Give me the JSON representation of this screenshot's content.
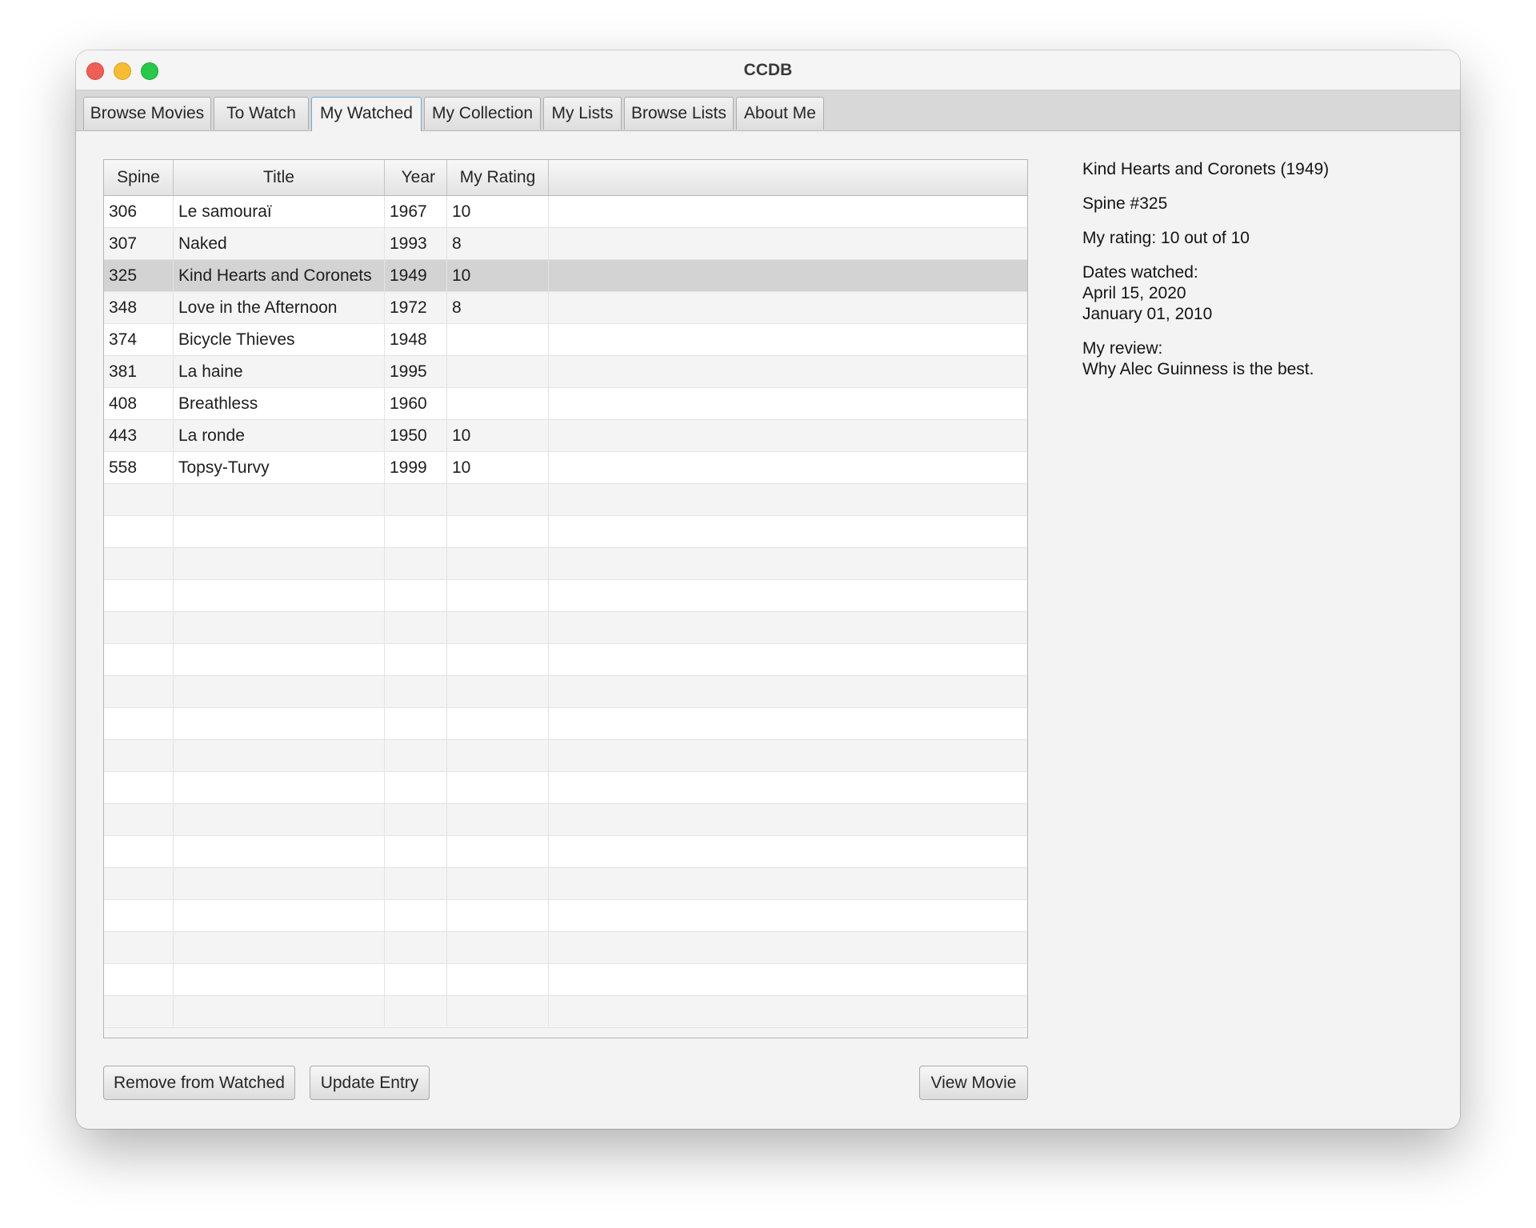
{
  "window": {
    "title": "CCDB"
  },
  "tabs": [
    {
      "label": "Browse Movies"
    },
    {
      "label": "To Watch"
    },
    {
      "label": "My Watched"
    },
    {
      "label": "My Collection"
    },
    {
      "label": "My Lists"
    },
    {
      "label": "Browse Lists"
    },
    {
      "label": "About Me"
    }
  ],
  "active_tab": "My Watched",
  "table": {
    "columns": [
      "Spine",
      "Title",
      "Year",
      "My Rating"
    ],
    "rows": [
      {
        "spine": "306",
        "title": "Le samouraï",
        "year": "1967",
        "rating": "10"
      },
      {
        "spine": "307",
        "title": "Naked",
        "year": "1993",
        "rating": "8"
      },
      {
        "spine": "325",
        "title": "Kind Hearts and Coronets",
        "year": "1949",
        "rating": "10"
      },
      {
        "spine": "348",
        "title": "Love in the Afternoon",
        "year": "1972",
        "rating": "8"
      },
      {
        "spine": "374",
        "title": "Bicycle Thieves",
        "year": "1948",
        "rating": ""
      },
      {
        "spine": "381",
        "title": "La haine",
        "year": "1995",
        "rating": ""
      },
      {
        "spine": "408",
        "title": "Breathless",
        "year": "1960",
        "rating": ""
      },
      {
        "spine": "443",
        "title": "La ronde",
        "year": "1950",
        "rating": "10"
      },
      {
        "spine": "558",
        "title": "Topsy-Turvy",
        "year": "1999",
        "rating": "10"
      }
    ],
    "selected_spine": "325"
  },
  "details": {
    "heading": "Kind Hearts and Coronets (1949)",
    "spine": "Spine #325",
    "rating": "My rating: 10 out of 10",
    "dates_label": "Dates watched:",
    "dates": [
      "April 15, 2020",
      "January 01, 2010"
    ],
    "review_label": "My review:",
    "review": "Why Alec Guinness is the best."
  },
  "buttons": {
    "remove": "Remove from Watched",
    "update": "Update Entry",
    "view": "View Movie"
  }
}
